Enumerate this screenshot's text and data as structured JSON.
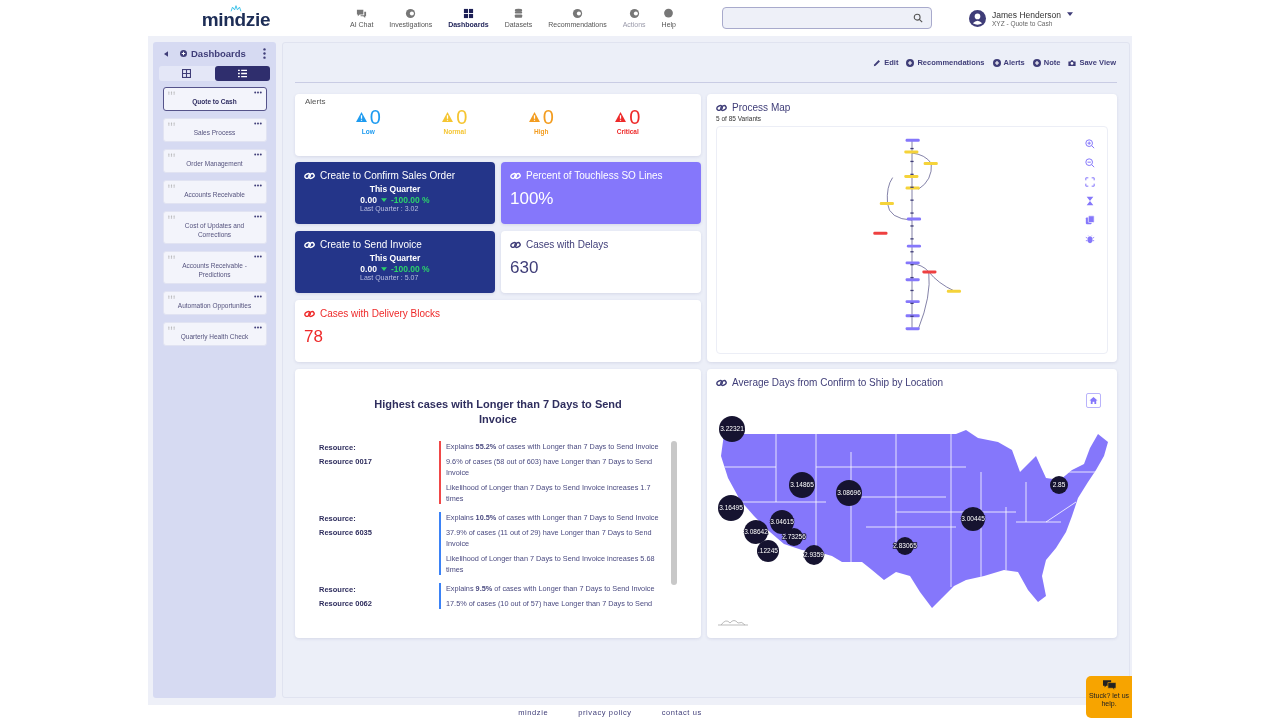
{
  "header": {
    "logo": "mindzie",
    "nav": [
      {
        "label": "AI Chat",
        "selected": false,
        "disabled": false
      },
      {
        "label": "Investigations",
        "selected": false,
        "disabled": false
      },
      {
        "label": "Dashboards",
        "selected": true,
        "disabled": false
      },
      {
        "label": "Datasets",
        "selected": false,
        "disabled": false
      },
      {
        "label": "Recommendations",
        "selected": false,
        "disabled": false
      },
      {
        "label": "Actions",
        "selected": false,
        "disabled": true
      },
      {
        "label": "Help",
        "selected": false,
        "disabled": false
      }
    ],
    "user": {
      "name": "James Henderson",
      "project": "XYZ - Quote to Cash"
    }
  },
  "sidebar": {
    "title": "Dashboards",
    "views": [
      {
        "kind": "grid",
        "selected": false
      },
      {
        "kind": "list",
        "selected": true
      }
    ],
    "items": [
      {
        "label": "Quote to Cash",
        "selected": true
      },
      {
        "label": "Sales Process",
        "selected": false
      },
      {
        "label": "Order Management",
        "selected": false
      },
      {
        "label": "Accounts Receivable",
        "selected": false
      },
      {
        "label": "Cost of Updates and Corrections",
        "selected": false
      },
      {
        "label": "Accounts Receivable - Predictions",
        "selected": false
      },
      {
        "label": "Automation Opportunities",
        "selected": false
      },
      {
        "label": "Quarterly Health Check",
        "selected": false
      }
    ]
  },
  "toolbar": [
    {
      "label": "Edit",
      "kind": "edit"
    },
    {
      "label": "Recommendations",
      "kind": "add"
    },
    {
      "label": "Alerts",
      "kind": "add"
    },
    {
      "label": "Note",
      "kind": "add"
    },
    {
      "label": "Save View",
      "kind": "camera"
    }
  ],
  "alerts": {
    "title": "Alerts",
    "levels": [
      {
        "count": "0",
        "label": "Low",
        "color": "#1e9bf0"
      },
      {
        "count": "0",
        "label": "Normal",
        "color": "#f5c531"
      },
      {
        "count": "0",
        "label": "High",
        "color": "#f39c1f"
      },
      {
        "count": "0",
        "label": "Critical",
        "color": "#ee2a2a"
      }
    ]
  },
  "metrics": [
    {
      "kind": "dark",
      "title": "Create to Confirm Sales Order",
      "period": "This Quarter",
      "value": "0.00",
      "change": "-100.00 %",
      "previous": "Last Quarter : 3.02"
    },
    {
      "kind": "accent",
      "title": "Percent of Touchless SO Lines",
      "value": "100%"
    },
    {
      "kind": "dark",
      "title": "Create to Send Invoice",
      "period": "This Quarter",
      "value": "0.00",
      "change": "-100.00 %",
      "previous": "Last Quarter : 5.07"
    },
    {
      "kind": "plain",
      "title": "Cases with Delays",
      "value": "630"
    },
    {
      "kind": "alert",
      "title": "Cases with Delivery Blocks",
      "value": "78"
    }
  ],
  "process_map": {
    "title": "Process Map",
    "subtitle": "5 of 85 Variants"
  },
  "insights": {
    "title": "Highest cases with Longer than 7 Days to Send Invoice",
    "groups": [
      {
        "label": "Resource:",
        "name": "Resource 0017",
        "color": "#f04848",
        "lines": [
          "Explains **55.2%** of cases with Longer than 7 Days to Send Invoice",
          "9.6% of cases (58 out of 603) have Longer than 7 Days to Send Invoice",
          "Likelihood of Longer than 7 Days to Send Invoice increases 1.7 times"
        ]
      },
      {
        "label": "Resource:",
        "name": "Resource 6035",
        "color": "#3b82f6",
        "lines": [
          "Explains **10.5%** of cases with Longer than 7 Days to Send Invoice",
          "37.9% of cases (11 out of 29) have Longer than 7 Days to Send Invoice",
          "Likelihood of Longer than 7 Days to Send Invoice increases 5.68 times"
        ]
      },
      {
        "label": "Resource:",
        "name": "Resource 0062",
        "color": "#3b82f6",
        "lines": [
          "Explains **9.5%** of cases with Longer than 7 Days to Send Invoice",
          "17.5% of cases (10 out of 57) have Longer than 7 Days to Send"
        ]
      }
    ]
  },
  "location_map": {
    "title": "Average Days from Confirm to Ship by Location",
    "markers": [
      {
        "label": "3.22321"
      },
      {
        "label": "3.14865"
      },
      {
        "label": "3.08696"
      },
      {
        "label": "3.16495"
      },
      {
        "label": "3.04615"
      },
      {
        "label": "3.00445"
      },
      {
        "label": "3.08642"
      },
      {
        "label": ".12245"
      },
      {
        "label": "2.73256"
      },
      {
        "label": "2.9359"
      },
      {
        "label": "2.83065"
      },
      {
        "label": "2.85"
      }
    ]
  },
  "footer": {
    "links": [
      "mindzie",
      "privacy policy",
      "contact us"
    ]
  },
  "help_widget": {
    "label": "Stuck? let us help."
  }
}
